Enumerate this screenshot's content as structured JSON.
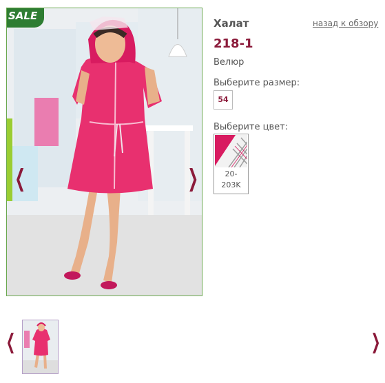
{
  "product": {
    "name": "Халат",
    "sku": "218-1",
    "material": "Велюр",
    "badge": "SALE"
  },
  "navigation": {
    "back_link": "назад к обзору",
    "prev_icon": "chevron-left-icon",
    "next_icon": "chevron-right-icon"
  },
  "size_selector": {
    "label": "Выберите размер:",
    "options": [
      "54"
    ]
  },
  "color_selector": {
    "label": "Выберите цвет:",
    "options": [
      {
        "code": "20-203K",
        "line1": "20-",
        "line2": "203K",
        "colors": [
          "#d81b60",
          "#f5f5f5",
          "#b0b0b0"
        ]
      }
    ]
  },
  "colors": {
    "accent": "#8b1a3a",
    "frame_border": "#6aa84f",
    "badge_bg": "#2e7d32",
    "robe": "#e8306f"
  }
}
